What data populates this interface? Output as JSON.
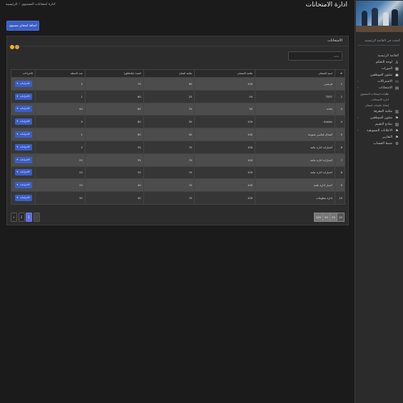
{
  "header": {
    "page_title": "ادارة الامتحانات",
    "breadcrumb": [
      "الرئيسية",
      "ادارة امتحانات المستوى"
    ]
  },
  "toolbar": {
    "add_label": "اضافة امتحان مستوى"
  },
  "sidebar": {
    "search_placeholder": "البحث في القائمة الرئيسية",
    "section_heading": "القائمة الرئيسية",
    "items": [
      {
        "label": "لوحة التحكم",
        "icon": "sitemap-icon",
        "has_children": false
      },
      {
        "label": "الدورات",
        "icon": "grid-icon",
        "has_children": false
      },
      {
        "label": "شئون الموظفين",
        "icon": "users-icon",
        "has_children": false
      },
      {
        "label": "الاشتراكات",
        "icon": "card-icon",
        "has_children": true
      },
      {
        "label": "الامتحانات",
        "icon": "book-icon",
        "has_children": true
      }
    ],
    "sub_items": [
      "طلبات امتحانات المستوى",
      "ادارة الامتحانات",
      "إنشاء جلسات امتحان"
    ],
    "items_after": [
      {
        "label": "مكتبة المعرفة",
        "icon": "library-icon",
        "has_children": false
      },
      {
        "label": "شئون الموظفين",
        "icon": "flag-icon",
        "has_children": true
      },
      {
        "label": "نماذج التقييم",
        "icon": "form-icon",
        "has_children": false
      },
      {
        "label": "الاعلانات التسويقية",
        "icon": "flag-icon",
        "has_children": true
      },
      {
        "label": "التقارير",
        "icon": "flag-icon",
        "has_children": false
      },
      {
        "label": "ضبط الحساب",
        "icon": "gear-icon",
        "has_children": false
      }
    ]
  },
  "card": {
    "title": "الامتحانات",
    "search_placeholder": "بحث"
  },
  "table": {
    "headers": [
      "#",
      "اسم الامتحان",
      "علامة الامتحان",
      "علامة النجاح",
      "المدة (بالدقائق)",
      "عدد الاسئلة",
      "الاجراءات"
    ],
    "action_label": "الاجراءات",
    "rows": [
      [
        "1",
        "فرنسي",
        "100",
        "60",
        "70",
        "2"
      ],
      [
        "2",
        "TEST",
        "50",
        "25",
        "60",
        "1"
      ],
      [
        "3",
        "cms",
        "50",
        "25",
        "60",
        "50"
      ],
      [
        "4",
        "Arabic",
        "100",
        "50",
        "60",
        "5"
      ],
      [
        "5",
        "امتحان قياسي متنوعة",
        "100",
        "50",
        "60",
        "1"
      ],
      [
        "6",
        "اختبارات ادارة عامة",
        "100",
        "70",
        "35",
        "2"
      ],
      [
        "7",
        "اختبارات ادارة عامة",
        "100",
        "70",
        "35",
        "25"
      ],
      [
        "8",
        "اختبارات ادارة عامة",
        "100",
        "70",
        "35",
        "25"
      ],
      [
        "9",
        "اختبار ادارة عامة",
        "100",
        "70",
        "40",
        "25"
      ],
      [
        "10",
        "ادارة معلومات",
        "100",
        "70",
        "40",
        "30"
      ]
    ]
  },
  "pagination": {
    "prev": "«",
    "pages": [
      "2",
      "1"
    ],
    "active_page": "1",
    "next": "»",
    "page_sizes": [
      "10",
      "25",
      "50",
      "100"
    ]
  },
  "colors": {
    "accent": "#3b5ec7",
    "active_page": "#5c6de0"
  }
}
